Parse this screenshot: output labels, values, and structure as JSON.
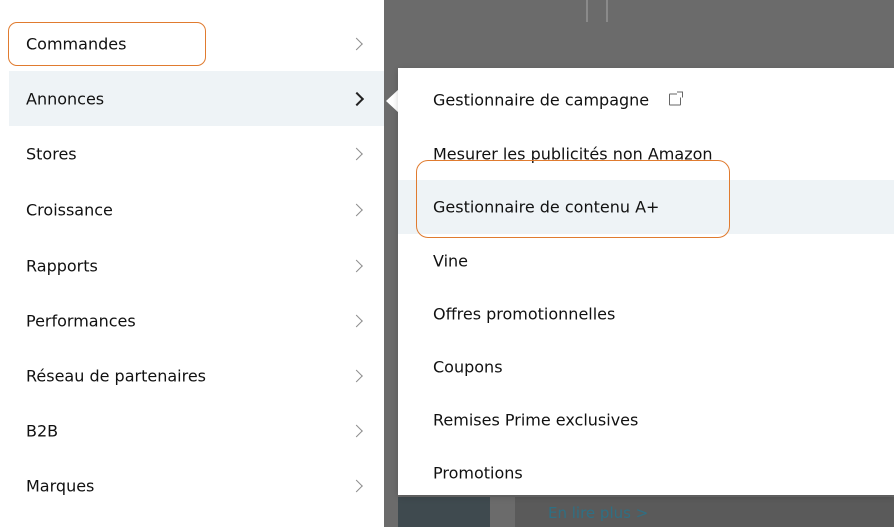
{
  "main_menu": {
    "items": [
      {
        "label": "Commandes"
      },
      {
        "label": "Annonces"
      },
      {
        "label": "Stores"
      },
      {
        "label": "Croissance"
      },
      {
        "label": "Rapports"
      },
      {
        "label": "Performances"
      },
      {
        "label": "Réseau de partenaires"
      },
      {
        "label": "B2B"
      },
      {
        "label": "Marques"
      }
    ],
    "active_index": 1
  },
  "sub_menu": {
    "items": [
      {
        "label": "Gestionnaire de campagne",
        "icon": "external-link-icon"
      },
      {
        "label": "Mesurer les publicités non Amazon"
      },
      {
        "label": "Gestionnaire de contenu A+"
      },
      {
        "label": "Vine"
      },
      {
        "label": "Offres promotionnelles"
      },
      {
        "label": "Coupons"
      },
      {
        "label": "Remises Prime exclusives"
      },
      {
        "label": "Promotions"
      }
    ],
    "highlighted_index": 2
  },
  "background": {
    "link_text": "En lire plus >"
  },
  "colors": {
    "highlight_outline": "#e07b2f",
    "active_row": "#eef3f6",
    "backdrop": "#6b6b6b"
  }
}
